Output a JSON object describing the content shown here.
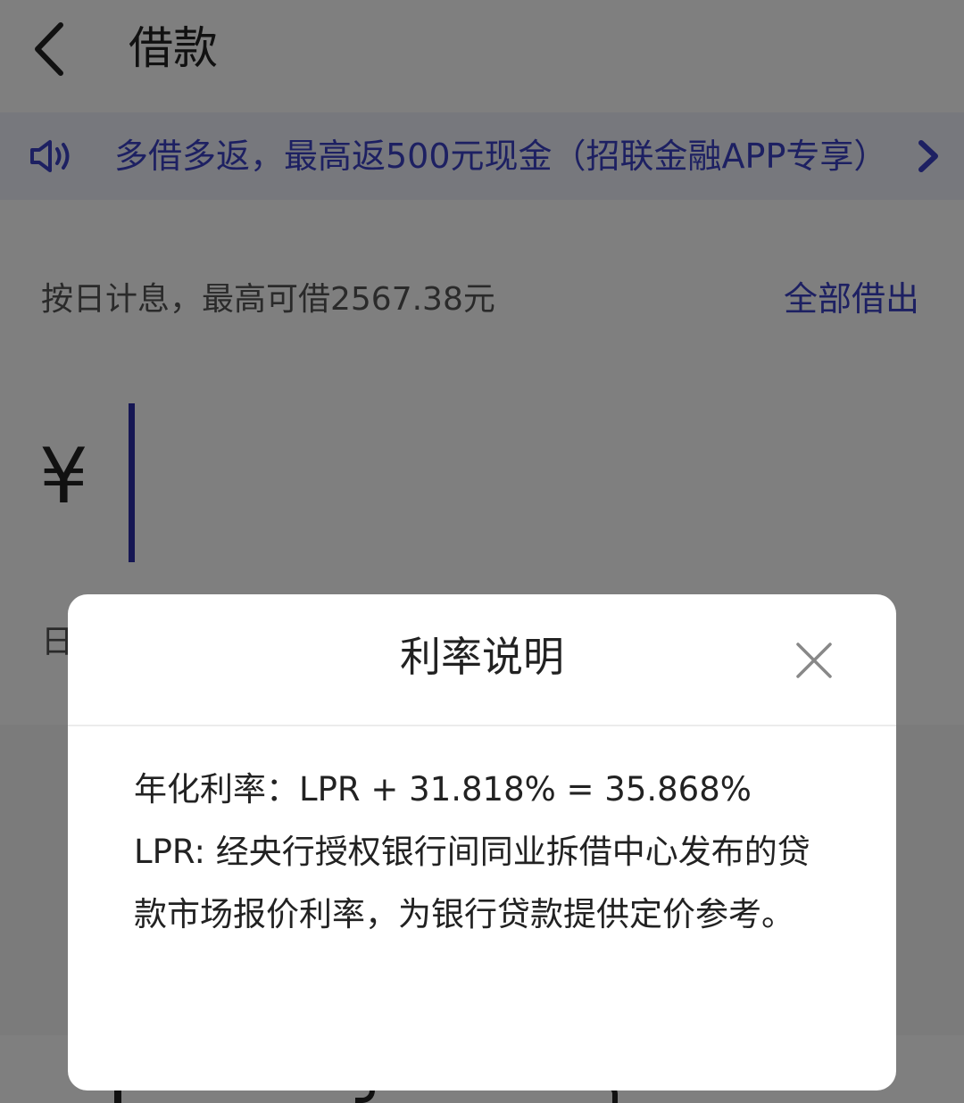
{
  "header": {
    "title": "借款"
  },
  "notice": {
    "text": "多借多返，最高返500元现金（招联金融APP专享）"
  },
  "info": {
    "text": "按日计息，最高可借2567.38元",
    "borrow_all_label": "全部借出"
  },
  "amount": {
    "currency_symbol": "¥",
    "value": ""
  },
  "below": {
    "text": "日"
  },
  "modal": {
    "title": "利率说明",
    "rate_line": "年化利率：LPR + 31.818% = 35.868%",
    "description": "LPR: 经央行授权银行间同业拆借中心发布的贷款市场报价利率，为银行贷款提供定价参考。"
  },
  "colors": {
    "accent": "#3a40c4",
    "cursor": "#2c2fa8",
    "notice_bg": "#eef0fb",
    "overlay": "rgba(0,0,0,0.5)"
  },
  "icons": {
    "back": "chevron-left-icon",
    "notice": "speaker-icon",
    "notice_arrow": "chevron-right-icon",
    "close": "close-icon"
  }
}
